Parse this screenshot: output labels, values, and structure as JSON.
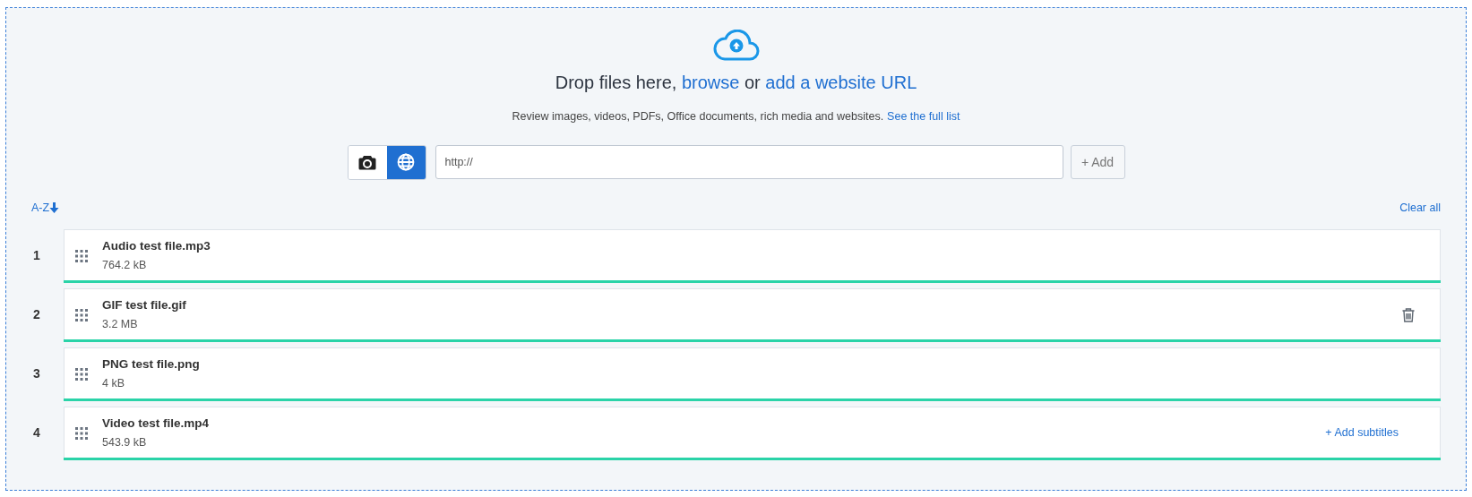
{
  "dropzone": {
    "heading": "Drop files here, **browse** or **add a website URL**",
    "description": "Review images, videos, PDFs, Office documents, rich media and websites.",
    "description_link": "See the full list",
    "sources": [
      {
        "kind": "camera",
        "selected": false
      },
      {
        "kind": "web",
        "selected": true
      }
    ],
    "url_field": {
      "value": "http://"
    },
    "add_button": "+ Add"
  },
  "sort": "A-Z",
  "clear_all": "Clear all",
  "files": [
    {
      "index": "1",
      "name": "Audio test file.mp3",
      "size": "764.2 kB",
      "level": 1,
      "hovered": false
    },
    {
      "index": "2",
      "name": "GIF test file.gif",
      "size": "3.2 MB",
      "level": 1,
      "hovered": true
    },
    {
      "index": "3",
      "name": "PNG test file.png",
      "size": "4 kB",
      "level": 1,
      "hovered": false
    },
    {
      "index": "4",
      "name": "Video test file.mp4",
      "size": "543.9 kB",
      "level": 1,
      "hovered": false,
      "subtitles_link": "+ Add subtitles"
    }
  ]
}
